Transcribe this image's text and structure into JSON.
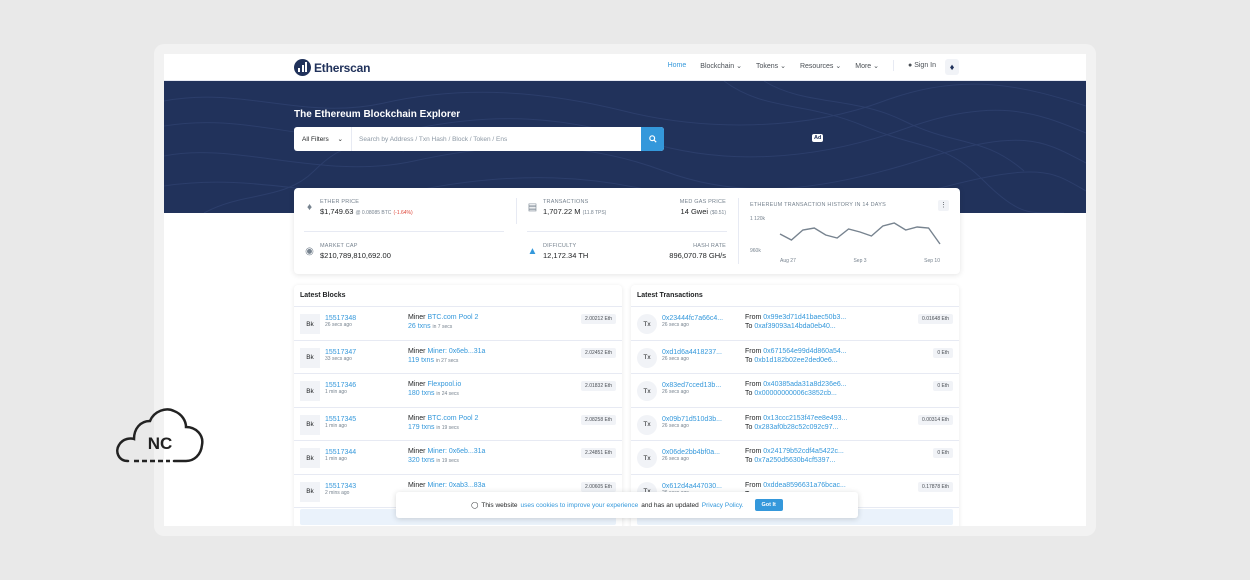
{
  "nav": {
    "logo_text": "Etherscan",
    "items": [
      {
        "label": "Home",
        "active": true
      },
      {
        "label": "Blockchain ⌄",
        "active": false
      },
      {
        "label": "Tokens ⌄",
        "active": false
      },
      {
        "label": "Resources ⌄",
        "active": false
      },
      {
        "label": "More ⌄",
        "active": false
      }
    ],
    "sign_in": "Sign In"
  },
  "hero": {
    "title": "The Ethereum Blockchain Explorer",
    "filter_label": "All Filters",
    "search_placeholder": "Search by Address / Txn Hash / Block / Token / Ens",
    "ad_badge": "Ad"
  },
  "stats": {
    "ether_price_label": "ETHER PRICE",
    "ether_price_value": "$1,749.63",
    "ether_price_btc": "@ 0.08085 BTC",
    "ether_price_change": "(-1.64%)",
    "market_cap_label": "MARKET CAP",
    "market_cap_value": "$210,789,810,692.00",
    "transactions_label": "TRANSACTIONS",
    "transactions_value": "1,707.22 M",
    "transactions_tps": "(11.8 TPS)",
    "gas_label": "MED GAS PRICE",
    "gas_value": "14 Gwei",
    "gas_usd": "($0.51)",
    "difficulty_label": "DIFFICULTY",
    "difficulty_value": "12,172.34 TH",
    "hashrate_label": "HASH RATE",
    "hashrate_value": "896,070.78 GH/s"
  },
  "chart_data": {
    "type": "line",
    "title": "ETHEREUM TRANSACTION HISTORY IN 14 DAYS",
    "y_ticks": [
      "1 120k",
      "960k"
    ],
    "x_ticks": [
      "Aug 27",
      "Sep 3",
      "Sep 10"
    ],
    "ylim": [
      960000,
      1120000
    ],
    "values": [
      1040000,
      1010000,
      1060000,
      1070000,
      1035000,
      1020000,
      1065000,
      1050000,
      1030000,
      1080000,
      1095000,
      1060000,
      1075000,
      1070000,
      990000
    ],
    "grid": false
  },
  "latest_blocks": {
    "title": "Latest Blocks",
    "rows": [
      {
        "badge": "Bk",
        "block": "15517348",
        "age": "26 secs ago",
        "miner_prefix": "Miner",
        "miner": "BTC.com Pool 2",
        "txns": "26 txns",
        "txn_time": "in 7 secs",
        "reward": "2.00212 Eth"
      },
      {
        "badge": "Bk",
        "block": "15517347",
        "age": "33 secs ago",
        "miner_prefix": "Miner",
        "miner": "Miner: 0x6eb...31a",
        "txns": "119 txns",
        "txn_time": "in 27 secs",
        "reward": "2.02452 Eth"
      },
      {
        "badge": "Bk",
        "block": "15517346",
        "age": "1 min ago",
        "miner_prefix": "Miner",
        "miner": "Flexpool.io",
        "txns": "180 txns",
        "txn_time": "in 24 secs",
        "reward": "2.01832 Eth"
      },
      {
        "badge": "Bk",
        "block": "15517345",
        "age": "1 min ago",
        "miner_prefix": "Miner",
        "miner": "BTC.com Pool 2",
        "txns": "179 txns",
        "txn_time": "in 19 secs",
        "reward": "2.08258 Eth"
      },
      {
        "badge": "Bk",
        "block": "15517344",
        "age": "1 min ago",
        "miner_prefix": "Miner",
        "miner": "Miner: 0x6eb...31a",
        "txns": "320 txns",
        "txn_time": "in 19 secs",
        "reward": "2.24851 Eth"
      },
      {
        "badge": "Bk",
        "block": "15517343",
        "age": "2 mins ago",
        "miner_prefix": "Miner",
        "miner": "Miner: 0xab3...83a",
        "txns": "",
        "txn_time": "",
        "reward": "2.00605 Eth"
      }
    ]
  },
  "latest_transactions": {
    "title": "Latest Transactions",
    "rows": [
      {
        "badge": "Tx",
        "hash": "0x23444fc7a66c4...",
        "age": "26 secs ago",
        "from": "0x99e3d71d41baec50b3...",
        "to": "0xaf39093a14bda0eb40...",
        "amount": "0.01648 Eth"
      },
      {
        "badge": "Tx",
        "hash": "0xd1d6a4418237...",
        "age": "26 secs ago",
        "from": "0x671564e99d4d860a54...",
        "to": "0xb1d182b02ee2ded0e6...",
        "amount": "0 Eth"
      },
      {
        "badge": "Tx",
        "hash": "0x83ed7cced13b...",
        "age": "26 secs ago",
        "from": "0x40385ada31a8d236e6...",
        "to": "0x00000000006c3852cb...",
        "amount": "0 Eth"
      },
      {
        "badge": "Tx",
        "hash": "0x09b71d510d3b...",
        "age": "26 secs ago",
        "from": "0x13ccc2153f47ee8e493...",
        "to": "0x283af0b28c52c092c97...",
        "amount": "0.00314 Eth"
      },
      {
        "badge": "Tx",
        "hash": "0x06de2bb4bf0a...",
        "age": "26 secs ago",
        "from": "0x24179b52cdf4a5422c...",
        "to": "0x7a250d5630b4cf5397...",
        "amount": "0 Eth"
      },
      {
        "badge": "Tx",
        "hash": "0x612d4a447030...",
        "age": "26 secs ago",
        "from": "0xddea8596631a76bcac...",
        "to": "",
        "amount": "0.17878 Eth"
      }
    ]
  },
  "cookie": {
    "prefix": "This website",
    "link1": "uses cookies to improve your experience",
    "middle": "and has an updated",
    "link2": "Privacy Policy.",
    "button": "Got It"
  },
  "watermark": {
    "text": "NC"
  }
}
